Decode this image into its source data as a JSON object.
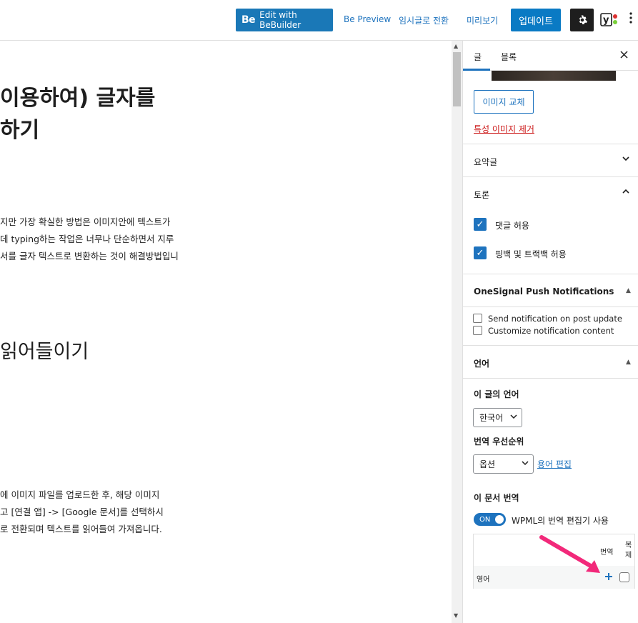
{
  "topbar": {
    "bebuilder_logo": "Be",
    "bebuilder_label": "Edit with BeBuilder",
    "be_preview": "Be Preview",
    "save_draft": "임시글로 전환",
    "preview": "미리보기",
    "update": "업데이트",
    "settings_icon": "gear-icon",
    "yoast_icon": "yoast-icon",
    "more_icon": "more-vertical-icon"
  },
  "editor": {
    "title_line1": "이용하여) 글자를",
    "title_line2": "하기",
    "para1_line1": "지만 가장 확실한 방법은 이미지안에 텍스트가",
    "para1_line2": "데 typing하는 작업은 너무나 단순하면서 지루",
    "para1_line3": "서를 글자 텍스트로 변환하는 것이 해결방법입니",
    "heading2": "읽어들이기",
    "para2_line1": "에 이미지 파일를 업로드한 후, 해당 이미지",
    "para2_line2": "고 [연결 앱] -> [Google 문서]를 선택하시",
    "para2_line3": "로 전환되며 텍스트를 읽어들여 가져옵니다."
  },
  "sidebar": {
    "tab_post": "글",
    "tab_block": "블록",
    "close_icon": "close-icon",
    "replace_image": "이미지 교체",
    "remove_image": "특성 이미지 제거",
    "excerpt": "요약글",
    "discussion": "토론",
    "allow_comments": "댓글 허용",
    "allow_pingbacks": "핑백 및 트랙백 허용",
    "onesignal_title": "OneSignal Push Notifications",
    "send_notification": "Send notification on post update",
    "customize_notification": "Customize notification content",
    "language_title": "언어",
    "post_language_label": "이 글의 언어",
    "post_language_value": "한국어",
    "translation_priority_label": "번역 우선순위",
    "translation_priority_value": "옵션",
    "edit_terms": "용어 편집",
    "translate_doc_label": "이 문서 번역",
    "toggle_state": "ON",
    "wpml_editor_label": "WPML의 번역 편집기 사용",
    "col_translation": "번역",
    "col_duplicate_1": "복",
    "col_duplicate_2": "제",
    "row_language": "영어",
    "add_icon": "plus-icon"
  },
  "colors": {
    "accent": "#1e73be",
    "update": "#0a7ac4",
    "arrow": "#f2297a",
    "danger": "#cc1818"
  }
}
